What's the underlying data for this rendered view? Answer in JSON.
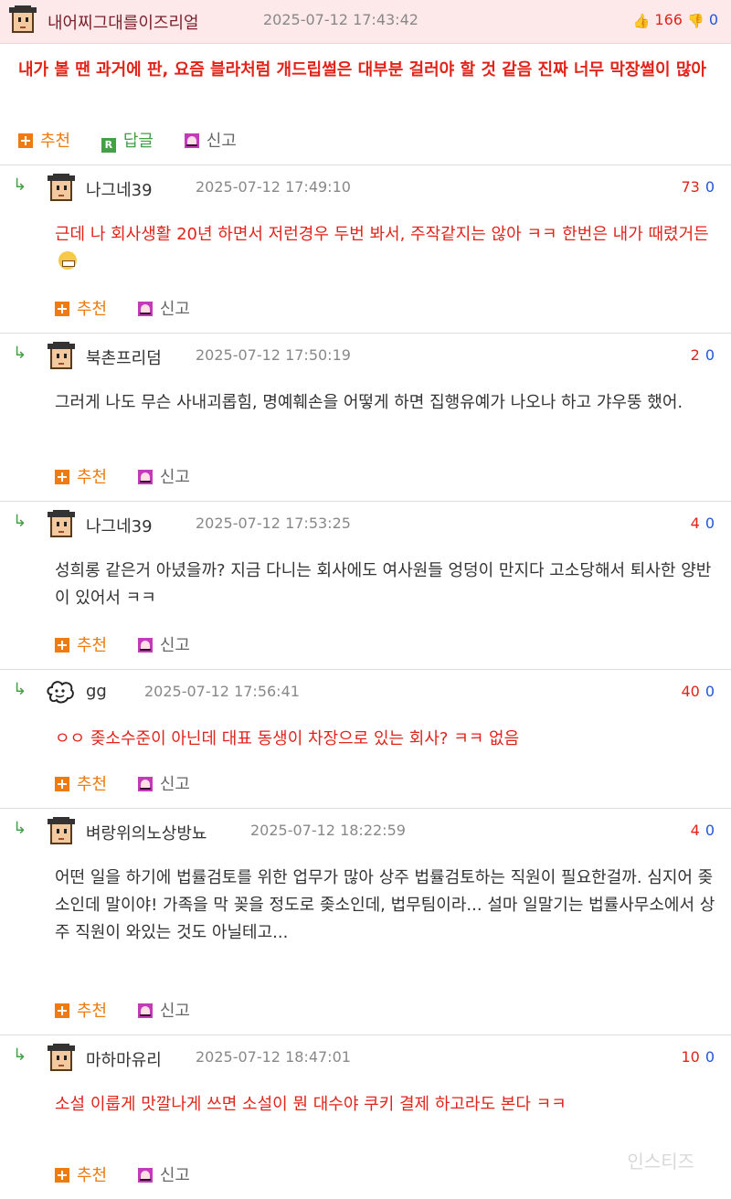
{
  "post": {
    "author": "내어찌그대를이즈리얼",
    "date": "2025-07-12 17:43:42",
    "upvotes": "166",
    "downvotes": "0",
    "text": "내가 볼 땐 과거에 판, 요즘 블라처럼 개드립썰은 대부분 걸러야 할 것 같음 진짜 너무 막장썰이 많아",
    "actions": {
      "recommend": "추천",
      "reply": "답글",
      "report": "신고"
    }
  },
  "comments": [
    {
      "author": "나그네39",
      "date": "2025-07-12 17:49:10",
      "up": "73",
      "down": "0",
      "text": "근데 나 회사생활 20년 하면서 저런경우 두번 봐서, 주작같지는 않아 ㅋㅋ 한번은 내가 때렸거든",
      "color": "red",
      "emoji": "grinning-emoji"
    },
    {
      "author": "북촌프리덤",
      "date": "2025-07-12 17:50:19",
      "up": "2",
      "down": "0",
      "text": "그러게 나도 무슨 사내괴롭힘, 명예훼손을 어떻게 하면 집행유예가 나오나 하고 갸우뚱 했어.",
      "color": "black"
    },
    {
      "author": "나그네39",
      "date": "2025-07-12 17:53:25",
      "up": "4",
      "down": "0",
      "text": "성희롱 같은거 아녔을까? 지금 다니는 회사에도 여사원들 엉덩이 만지다 고소당해서 퇴사한 양반이 있어서 ㅋㅋ",
      "color": "black"
    },
    {
      "author": "gg",
      "date": "2025-07-12 17:56:41",
      "up": "40",
      "down": "0",
      "text": "ㅇㅇ 좆소수준이 아닌데 대표 동생이 차장으로 있는 회사? ㅋㅋ 없음",
      "color": "red"
    },
    {
      "author": "벼랑위의노상방뇨",
      "date": "2025-07-12 18:22:59",
      "up": "4",
      "down": "0",
      "text": "어떤 일을 하기에 법률검토를 위한 업무가 많아 상주 법률검토하는 직원이 필요한걸까. 심지어 좆소인데 말이야! 가족을 막 꽂을 정도로 좆소인데, 법무팀이라... 설마 일말기는 법률사무소에서 상주 직원이 와있는 것도 아닐테고...",
      "color": "black"
    },
    {
      "author": "마하마유리",
      "date": "2025-07-12 18:47:01",
      "up": "10",
      "down": "0",
      "text": "소설 이룹게 맛깔나게 쓰면 소설이 뭔 대수야 쿠키 결제 하고라도 본다 ㅋㅋ",
      "color": "red"
    }
  ],
  "comment_actions": {
    "recommend": "추천",
    "report": "신고"
  },
  "reply_arrow": "↳",
  "watermark": "인스티즈"
}
